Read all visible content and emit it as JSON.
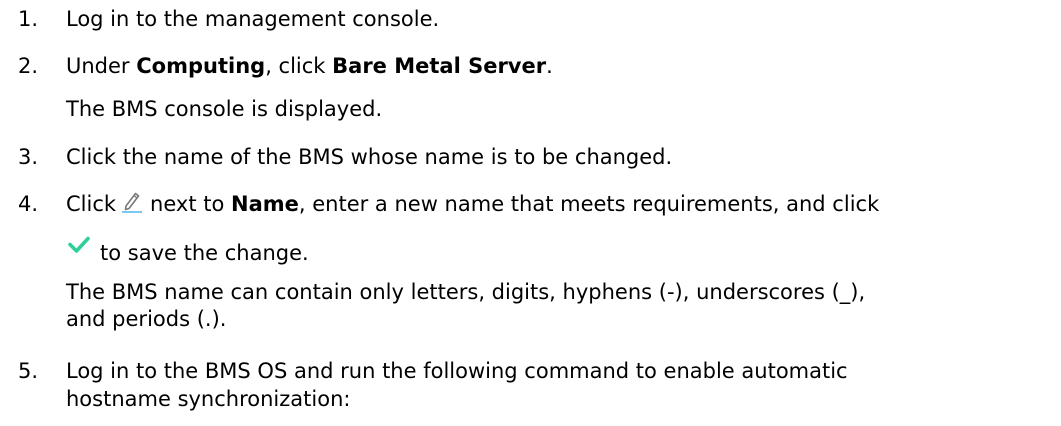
{
  "steps": [
    {
      "number": "1.",
      "text": "Log in to the management console."
    },
    {
      "number": "2.",
      "prefix": "Under ",
      "bold1": "Computing",
      "middle": ", click ",
      "bold2": "Bare Metal Server",
      "suffix": ".",
      "note": "The BMS console is displayed."
    },
    {
      "number": "3.",
      "text": "Click the name of the BMS whose name is to be changed."
    },
    {
      "number": "4.",
      "prefix": "Click",
      "icon1": "pencil-edit-icon",
      "middle": "next to ",
      "bold": "Name",
      "suffix": ", enter a new name that meets requirements, and click",
      "icon2": "checkmark-icon",
      "line2": "to save the change.",
      "note_line1": "The BMS name can contain only letters, digits, hyphens (-), underscores (_),",
      "note_line2": "and periods (.)."
    },
    {
      "number": "5.",
      "line1": "Log in to the BMS OS and run the following command to enable automatic",
      "line2": "hostname synchronization:"
    }
  ],
  "colors": {
    "text": "#000000",
    "pencil": "#7a7a7a",
    "pencil_underline": "#7bc8f0",
    "check": "#2ecf9a"
  }
}
